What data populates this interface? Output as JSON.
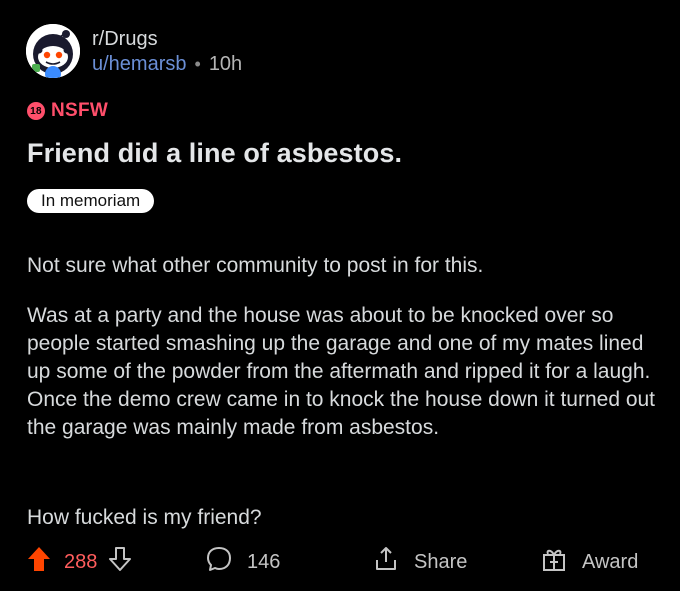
{
  "post": {
    "subreddit": "r/Drugs",
    "author": "u/hemarsb",
    "separator": "•",
    "age": "10h",
    "nsfw_badge_number": "18",
    "nsfw_label": "NSFW",
    "title": "Friend did a line of asbestos.",
    "flair": "In memoriam",
    "body": [
      "Not sure what other community to post in for this.",
      "Was at a party and the house was about to be knocked over so people started smashing up the garage and one of my mates lined up some of the powder from the aftermath and ripped it for a laugh. Once the demo crew came in to knock the house down it turned out the garage was mainly made from asbestos.",
      "How fucked is my friend?"
    ]
  },
  "actions": {
    "score": "288",
    "comments": "146",
    "share_label": "Share",
    "award_label": "Award"
  },
  "icons": {
    "upvote": "arrow-up-icon",
    "downvote": "arrow-down-icon",
    "comment": "comment-bubble-icon",
    "share": "share-icon",
    "award": "gift-award-icon"
  },
  "colors": {
    "background": "#000000",
    "upvote": "#ff4500",
    "nsfw": "#ff4f6b",
    "username": "#6b8fd6"
  }
}
